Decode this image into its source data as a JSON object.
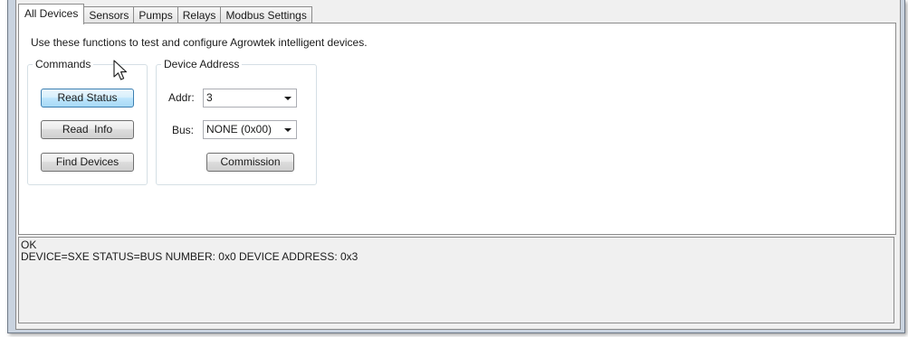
{
  "tabs": [
    {
      "label": "All Devices",
      "active": true
    },
    {
      "label": "Sensors",
      "active": false
    },
    {
      "label": "Pumps",
      "active": false
    },
    {
      "label": "Relays",
      "active": false
    },
    {
      "label": "Modbus Settings",
      "active": false
    }
  ],
  "panel": {
    "intro": "Use these functions to test and configure Agrowtek intelligent devices."
  },
  "commands": {
    "legend": "Commands",
    "read_status": "Read Status",
    "read_info": "Read  Info",
    "find_devices": "Find Devices"
  },
  "device_address": {
    "legend": "Device Address",
    "addr_label": "Addr:",
    "addr_value": "3",
    "bus_label": "Bus:",
    "bus_value": "NONE (0x00)",
    "commission": "Commission"
  },
  "output": {
    "lines": [
      "OK",
      "DEVICE=SXE STATUS=BUS NUMBER: 0x0 DEVICE ADDRESS: 0x3"
    ]
  },
  "icons": {
    "dropdown": "chevron-down-icon",
    "cursor": "mouse-pointer-icon"
  },
  "colors": {
    "hover_button": "#bee6fd",
    "frame": "#c9d3df",
    "group_border": "#d5dfe5"
  }
}
